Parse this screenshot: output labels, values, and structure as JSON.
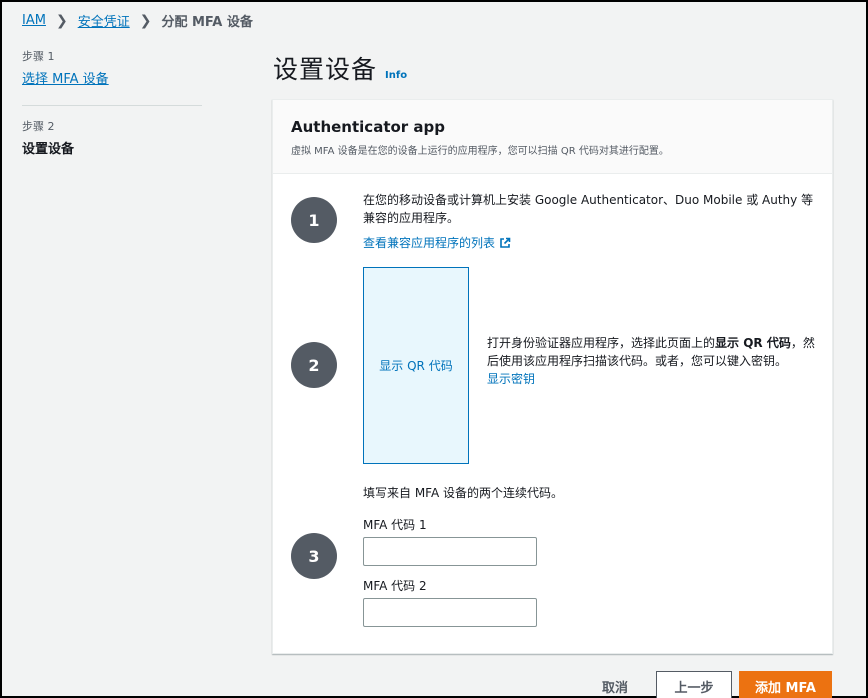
{
  "breadcrumb": {
    "items": [
      "IAM",
      "安全凭证"
    ],
    "current": "分配 MFA 设备"
  },
  "steps": {
    "step1_caption": "步骤 1",
    "step1_label": "选择 MFA 设备",
    "step2_caption": "步骤 2",
    "step2_label": "设置设备"
  },
  "header": {
    "title": "设置设备",
    "info": "Info"
  },
  "card": {
    "title": "Authenticator app",
    "description": "虚拟 MFA 设备是在您的设备上运行的应用程序，您可以扫描 QR 代码对其进行配置。",
    "step1": {
      "number": "1",
      "text": "在您的移动设备或计算机上安装 Google Authenticator、Duo Mobile 或 Authy 等兼容的应用程序。",
      "link": "查看兼容应用程序的列表"
    },
    "step2": {
      "number": "2",
      "qr_button": "显示 QR 代码",
      "text_before": "打开身份验证器应用程序，选择此页面上的",
      "text_bold": "显示 QR 代码",
      "text_after": "，然后使用该应用程序扫描该代码。或者，您可以键入密钥。",
      "secret_link": "显示密钥"
    },
    "step3": {
      "number": "3",
      "intro": "填写来自 MFA 设备的两个连续代码。",
      "code1_label": "MFA 代码 1",
      "code1_value": "",
      "code2_label": "MFA 代码 2",
      "code2_value": ""
    }
  },
  "footer": {
    "cancel": "取消",
    "previous": "上一步",
    "submit": "添加 MFA"
  },
  "colors": {
    "link": "#0073bb",
    "primary_button": "#ec7211",
    "step_circle": "#545b64"
  }
}
